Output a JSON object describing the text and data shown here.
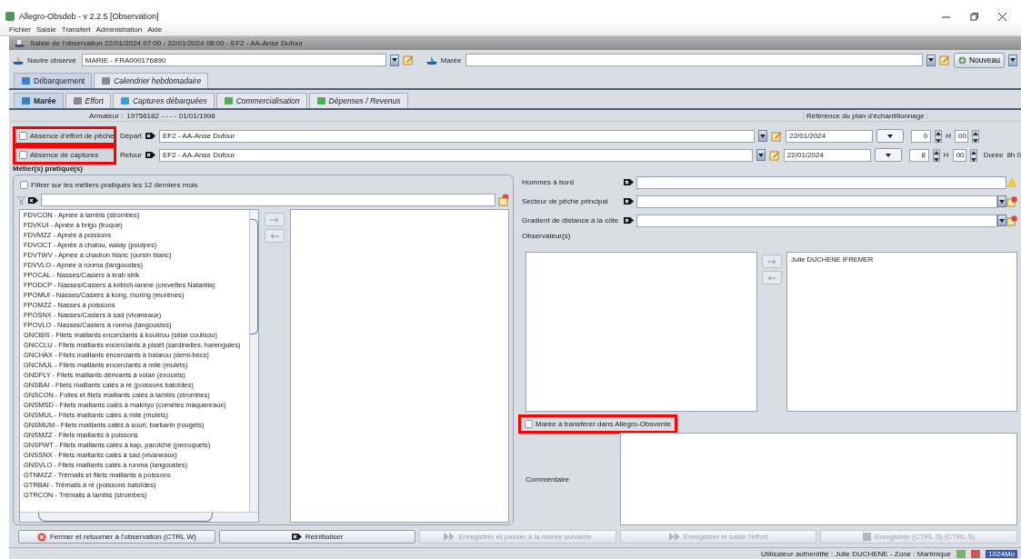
{
  "app_title": "Allegro-Obsdeb - v 2.2.5 [Observation]",
  "menu": [
    "Fichier",
    "Saisie",
    "Transfert",
    "Administration",
    "Aide"
  ],
  "frame_title": "Saisie de l'observation 22/01/2024 07:00 - 22/01/2024 08:00 - EF2 - AA-Anse Dufour",
  "navire": {
    "label": "Navire observé",
    "value": "MARIE - FRA000176890"
  },
  "maree": {
    "label": "Marée"
  },
  "new_button": "Nouveau",
  "tabs": [
    {
      "label": "Débarquement",
      "selected": true
    },
    {
      "label": "Calendrier hebdomadaire",
      "selected": false
    }
  ],
  "subtabs": [
    {
      "label": "Marée",
      "selected": true
    },
    {
      "label": "Effort",
      "selected": false
    },
    {
      "label": "Captures débarquées",
      "selected": false
    },
    {
      "label": "Commercialisation",
      "selected": false
    },
    {
      "label": "Dépenses / Revenus",
      "selected": false
    }
  ],
  "armateur": {
    "label": "Armateur :",
    "value": "19756182 - - - - 01/01/1998"
  },
  "plan_reference_label": "Référence du plan d'échantillonnage :",
  "trip_rows": [
    {
      "checkbox": {
        "label": "Absence d'effort de pêche",
        "checked": false,
        "highlighted": true
      },
      "label": "Départ",
      "location": "EF2 - AA-Anse Dufour",
      "date": "22/01/2024",
      "hour": "0",
      "h_label": "H",
      "minutes": "00"
    },
    {
      "checkbox": {
        "label": "Absence de captures",
        "checked": false,
        "highlighted": true
      },
      "label": "Retour",
      "location": "EF2 - AA-Anse Dufour",
      "date": "22/01/2024",
      "hour": "8",
      "h_label": "H",
      "minutes": "00",
      "duration_label": "Durée",
      "duration": "8h 0"
    }
  ],
  "metiers": {
    "title": "Métier(s) pratiqué(s)",
    "filter": {
      "label": "Filtrer sur les métiers pratiqués les 12 derniers mois",
      "checked": false
    },
    "available": [
      "FDVCON - Apnée à lambis (strombes)",
      "FDVKUI - Apnée à brigo (troque)",
      "FDVMZZ - Apnée à poissons",
      "FDVOCT - Apnée à chatou, walay (poulpes)",
      "FDVTWV - Apnée à chadron blanc (oursin blanc)",
      "FDVVLO - Apnée à ronma (langoustes)",
      "FPOCAL - Nasses/Casiers à krab sirik",
      "FPODCP - Nasses/Casiers à kribich-lanmè (crevettes Natantia)",
      "FPOMUI - Nasses/Casiers à kong, moring (murènes)",
      "FPOMZZ - Nasses à poissons",
      "FPOSNX - Nasses/Casiers à sad (vivaneaux)",
      "FPOVLO - Nasses/Casiers à ronma (langoustes)",
      "GNCBIS - Filets maillants encerclants à koulirou (sélar coulisou)",
      "GNCCLU - Filets maillants encerclants à pisièt (sardinelles, harengules)",
      "GNCHAX - Filets maillants encerclants à balarou (demi-becs)",
      "GNCMUL - Filets maillants encerclants à milé (mulets)",
      "GNDFLY - Filets maillants dérivants à volan (exocets)",
      "GNSBAI - Filets maillants calés à ré (poissons batoïdes)",
      "GNSCON - Folles et filets maillants calés à lambis (strombes)",
      "GNSMSD - Filets maillants calés à makriyo (comètes maquereaux)",
      "GNSMUL - Filets maillants calés à milé (mulets)",
      "GNSMUM - Filets maillants calés à souri, barbarin (rougets)",
      "GNSMZZ - Filets maillants à poissons",
      "GNSPWT - Filets maillants calés à kap, parotché (perroquets)",
      "GNSSNX - Filets maillants calés à sad (vivaneaux)",
      "GNSVLO - Filets maillants calés à ronma (langoustes)",
      "GTNMZZ - Trémails et filets maillants à poissons",
      "GTRBAI - Trémails à ré (poissons batoïdes)",
      "GTRCON - Trémails à lambis (strombes)"
    ]
  },
  "fields": [
    {
      "label": "Hommes à bord",
      "kind": "text",
      "warning": true
    },
    {
      "label": "Secteur de pêche principal",
      "kind": "combo",
      "warning": false
    },
    {
      "label": "Gradient de distance à la côte",
      "kind": "combo",
      "warning": false
    }
  ],
  "observers": {
    "label": "Observateur(s)",
    "selected": [
      "Julie DUCHENE IFREMER"
    ]
  },
  "transfer_checkbox": {
    "label": "Marée à transférer dans Allegro-Obsvente",
    "checked": false,
    "highlighted": true
  },
  "comment_label": "Commentaire",
  "buttons": [
    {
      "label": "Fermer et retourner à l'observation (CTRL W)",
      "kind": "close",
      "disabled": false
    },
    {
      "label": "Réinitialiser",
      "kind": "reset",
      "disabled": false
    },
    {
      "label": "Enregistrer et passer à la marée suivante",
      "kind": "next",
      "disabled": true
    },
    {
      "label": "Enregistrer et saisir l'effort",
      "kind": "next",
      "disabled": true
    },
    {
      "label": "Enregistrer (CTRL S) (CTRL S)",
      "kind": "save",
      "disabled": true
    }
  ],
  "status_bar": {
    "text": "Utilisateur authentifié : Julie DUCHENE - Zone : Martinique",
    "memory": "1024Mo"
  }
}
